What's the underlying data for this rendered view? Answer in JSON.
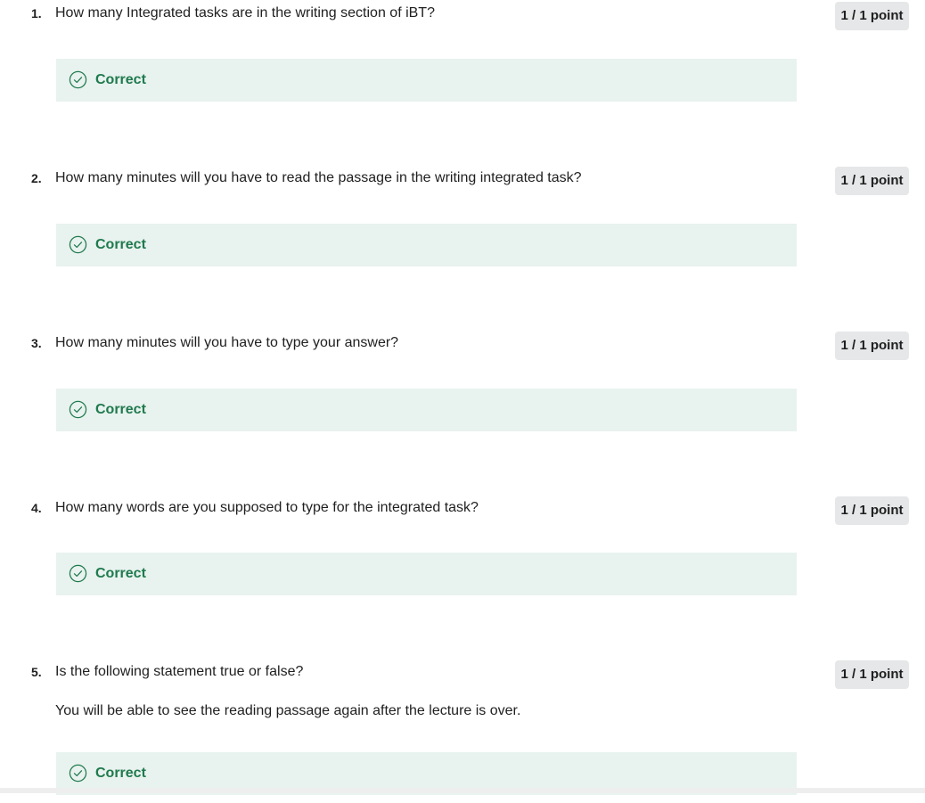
{
  "questions": [
    {
      "number": "1.",
      "text": "How many Integrated tasks are in the writing section of iBT?",
      "points": "1 / 1 point",
      "feedback": "Correct"
    },
    {
      "number": "2.",
      "text": "How many minutes will you have to read the passage in the writing integrated task?",
      "points": "1 / 1 point",
      "feedback": "Correct"
    },
    {
      "number": "3.",
      "text": "How many minutes will you have to type your answer?",
      "points": "1 / 1 point",
      "feedback": "Correct"
    },
    {
      "number": "4.",
      "text": "How many words are you supposed to type for the integrated task?",
      "points": "1 / 1 point",
      "feedback": "Correct"
    },
    {
      "number": "5.",
      "text": "Is the following statement true or false?",
      "subtext": "You will be able to see the reading passage again after the lecture is over.",
      "points": "1 / 1 point",
      "feedback": "Correct"
    }
  ],
  "icons": {
    "feedback": "check-circle-icon"
  },
  "colors": {
    "correct_text": "#1f7a4d",
    "correct_background": "#e8f2ef",
    "points_badge_background": "#e5e7e8"
  }
}
